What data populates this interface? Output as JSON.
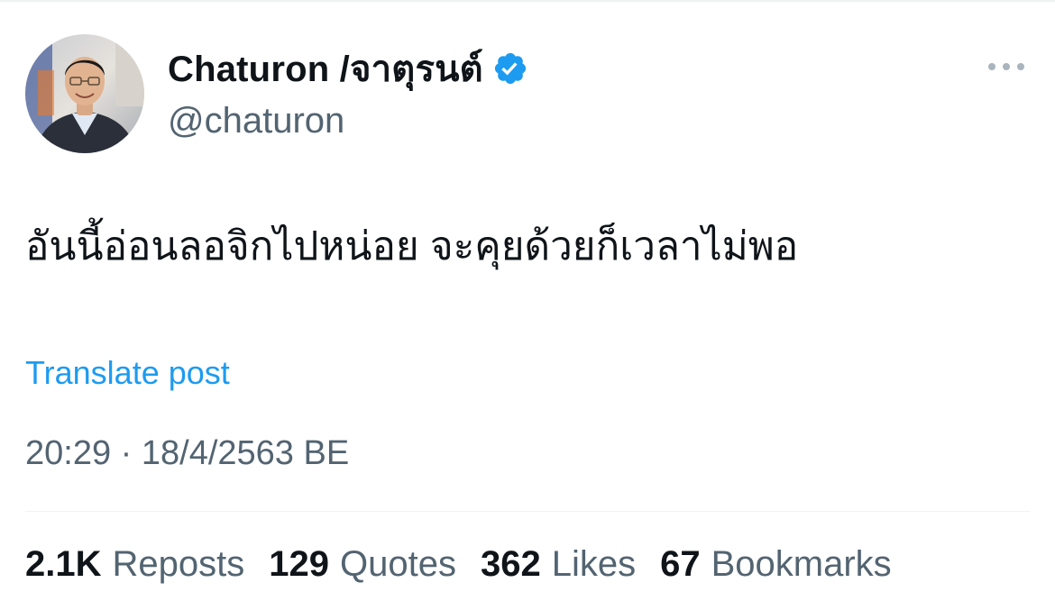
{
  "author": {
    "display_name": "Chaturon /จาตุรนต์",
    "handle": "@chaturon",
    "verified_icon": "verified-badge-icon",
    "avatar": "profile-photo"
  },
  "menu": {
    "more_icon": "more-options-icon"
  },
  "post": {
    "text": "อันนี้อ่อนลอจิกไปหน่อย จะคุยด้วยก็เวลาไม่พอ",
    "translate_label": "Translate post",
    "timestamp": "20:29 · 18/4/2563 BE"
  },
  "stats": [
    {
      "count": "2.1K",
      "label": "Reposts"
    },
    {
      "count": "129",
      "label": "Quotes"
    },
    {
      "count": "362",
      "label": "Likes"
    },
    {
      "count": "67",
      "label": "Bookmarks"
    }
  ],
  "colors": {
    "primary_text": "#0f1419",
    "secondary_text": "#536471",
    "link": "#1d9bf0",
    "divider": "#eff3f4"
  }
}
